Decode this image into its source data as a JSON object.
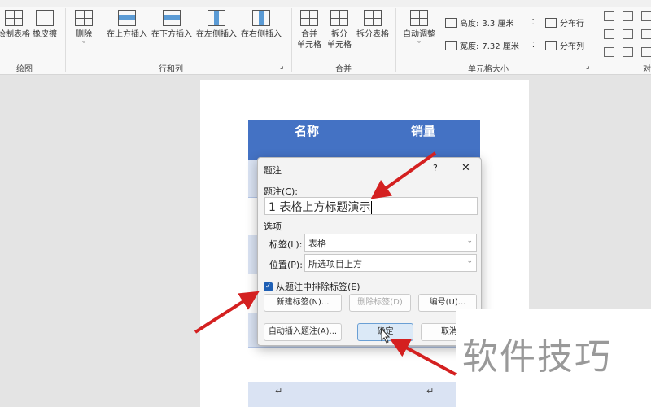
{
  "ribbon": {
    "buttons": {
      "draw_table": "绘制表格",
      "eraser": "橡皮擦",
      "delete": "删除",
      "insert_above": "在上方插入",
      "insert_below": "在下方插入",
      "insert_left": "在左侧插入",
      "insert_right": "在右侧插入",
      "merge_cells_1": "合并",
      "merge_cells_2": "单元格",
      "split_cells_1": "拆分",
      "split_cells_2": "单元格",
      "split_table": "拆分表格",
      "autofit": "自动调整",
      "distribute_rows": "分布行",
      "distribute_cols": "分布列"
    },
    "height_label": "高度:",
    "height_value": "3.3 厘米",
    "width_label": "宽度:",
    "width_value": "7.32 厘米",
    "groups": {
      "draw": "绘图",
      "rows_cols": "行和列",
      "merge": "合并",
      "cell_size": "单元格大小",
      "align": "对"
    }
  },
  "table": {
    "headers": [
      "名称",
      "销量"
    ],
    "para_mark": "↵"
  },
  "dialog": {
    "title": "题注",
    "help": "?",
    "close": "✕",
    "caption_label": "题注(C):",
    "caption_value": "1 表格上方标题演示",
    "options_label": "选项",
    "label_label": "标签(L):",
    "label_value": "表格",
    "position_label": "位置(P):",
    "position_value": "所选项目上方",
    "exclude_label": "从题注中排除标签(E)",
    "exclude_checked": true,
    "new_label": "新建标签(N)...",
    "delete_label": "删除标签(D)",
    "numbering": "编号(U)...",
    "autocaption": "自动插入题注(A)...",
    "ok": "确定",
    "cancel": "取消"
  },
  "watermark": {
    "text": "软件技巧"
  },
  "colors": {
    "table_header": "#4472c4",
    "arrow": "#d42020",
    "checkbox": "#1e5fb4"
  }
}
